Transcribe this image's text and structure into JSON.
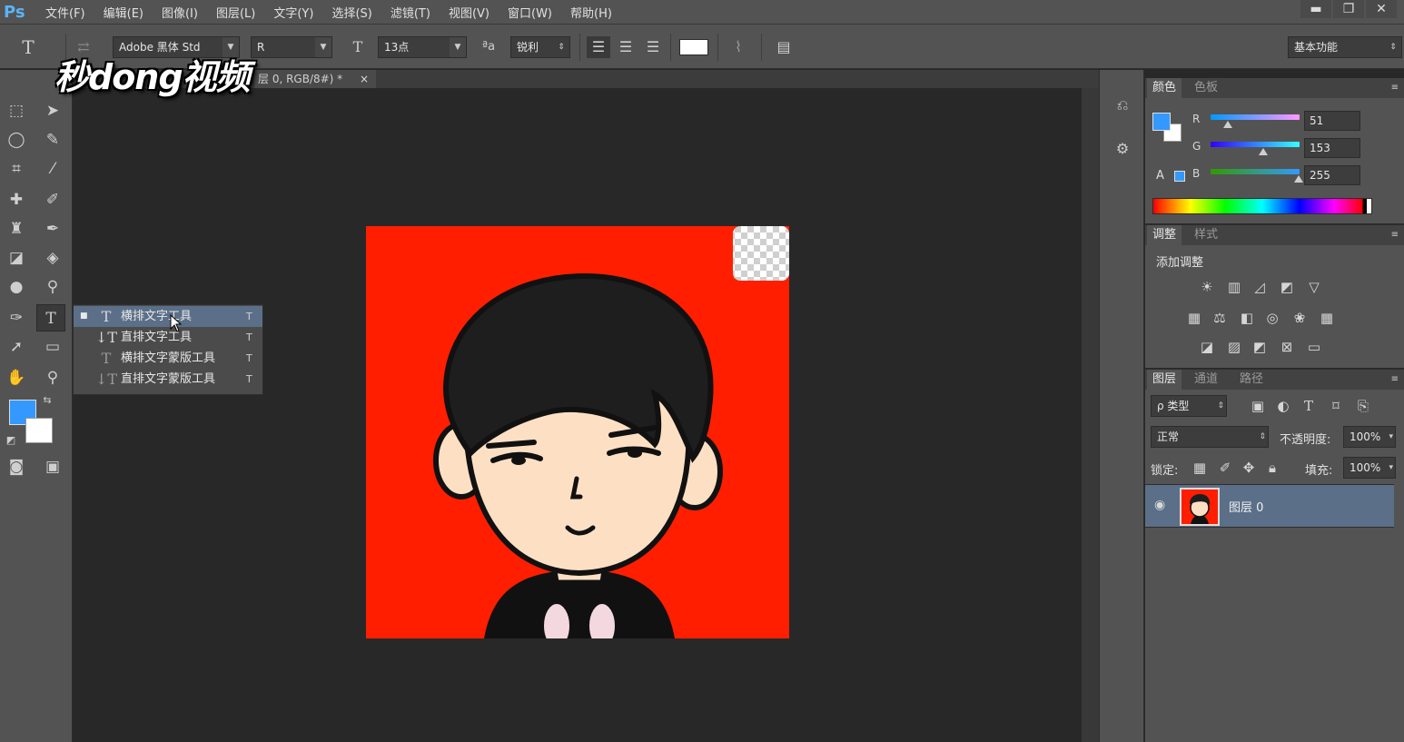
{
  "app": {
    "logo": "Ps"
  },
  "menu": [
    "文件(F)",
    "编辑(E)",
    "图像(I)",
    "图层(L)",
    "文字(Y)",
    "选择(S)",
    "滤镜(T)",
    "视图(V)",
    "窗口(W)",
    "帮助(H)"
  ],
  "window_controls": {
    "minimize": "▬",
    "restore": "❐",
    "close": "✕"
  },
  "options": {
    "tool_glyph": "T",
    "font_family": "Adobe 黑体 Std",
    "font_style": "R",
    "size_glyph": "T",
    "font_size": "13点",
    "aa_glyph": "ªa",
    "antialias": "锐利",
    "workspace": "基本功能"
  },
  "watermark": "秒dong视频",
  "document": {
    "tab_title": "层 0, RGB/8#) *",
    "close": "×"
  },
  "flyout": [
    {
      "icon": "T",
      "label": "横排文字工具",
      "key": "T",
      "selected": true
    },
    {
      "icon": "↓T",
      "label": "直排文字工具",
      "key": "T",
      "selected": false
    },
    {
      "icon": "T",
      "label": "横排文字蒙版工具",
      "key": "T",
      "selected": false
    },
    {
      "icon": "↓T",
      "label": "直排文字蒙版工具",
      "key": "T",
      "selected": false
    }
  ],
  "color_panel": {
    "tabs": [
      "颜色",
      "色板"
    ],
    "channels": [
      {
        "label": "R",
        "value": "51"
      },
      {
        "label": "G",
        "value": "153"
      },
      {
        "label": "B",
        "value": "255"
      }
    ],
    "foreground": "#3399ff",
    "background": "#ffffff"
  },
  "adjust_panel": {
    "tabs": [
      "调整",
      "样式"
    ],
    "title": "添加调整"
  },
  "layers_panel": {
    "tabs": [
      "图层",
      "通道",
      "路径"
    ],
    "filter": "ρ 类型",
    "blend_mode": "正常",
    "opacity_label": "不透明度:",
    "opacity": "100%",
    "lock_label": "锁定:",
    "fill_label": "填充:",
    "fill": "100%",
    "layer_name": "图层 0"
  },
  "colors": {
    "canvas_red": "#ff1f00",
    "selection": "#5b6f88",
    "accent": "#3399ff"
  }
}
